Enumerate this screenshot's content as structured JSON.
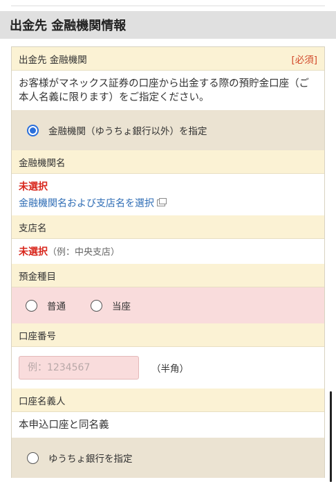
{
  "section": {
    "title": "出金先 金融機関情報"
  },
  "withdrawal_bank": {
    "label": "出金先 金融機関",
    "required": "[必須]",
    "description": "お客様がマネックス証券の口座から出金する際の預貯金口座（ご本人名義に限ります）をご指定ください。",
    "option_label": "金融機関（ゆうちょ銀行以外）を指定"
  },
  "bank_name": {
    "label": "金融機関名",
    "status": "未選択",
    "link": "金融機関名および支店名を選択"
  },
  "branch_name": {
    "label": "支店名",
    "status": "未選択",
    "example": "（例：中央支店）"
  },
  "deposit_type": {
    "label": "預金種目",
    "options": [
      "普通",
      "当座"
    ]
  },
  "account_number": {
    "label": "口座番号",
    "placeholder": "例：1234567",
    "note": "（半角）"
  },
  "account_holder": {
    "label": "口座名義人",
    "value": "本申込口座と同名義"
  },
  "yucho": {
    "option_label": "ゆうちょ銀行を指定"
  },
  "colors": {
    "label_bg": "#fbf2d4",
    "selected_bg": "#ebe3d2",
    "error_bg": "#f9dcdc",
    "required": "#d24a2b",
    "unselected": "#d8261c",
    "link": "#2f6db5",
    "radio_checked": "#2a6fdb"
  },
  "icons": {
    "external": "external-window-icon"
  }
}
